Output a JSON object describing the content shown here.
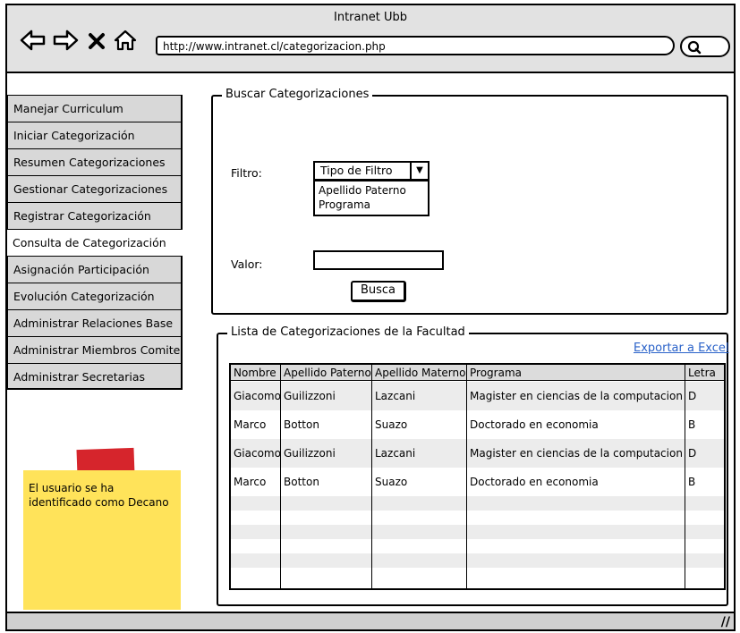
{
  "window": {
    "title": "Intranet Ubb",
    "url": "http://www.intranet.cl/categorizacion.php"
  },
  "sidebar": {
    "items": [
      {
        "label": "Manejar Curriculum"
      },
      {
        "label": "Iniciar Categorización"
      },
      {
        "label": "Resumen Categorizaciones"
      },
      {
        "label": "Gestionar Categorizaciones"
      },
      {
        "label": "Registrar Categorización"
      },
      {
        "label": "Consulta de Categorización"
      },
      {
        "label": "Asignación Participación"
      },
      {
        "label": "Evolución Categorización"
      },
      {
        "label": "Administrar Relaciones Base"
      },
      {
        "label": "Administrar Miembros Comite"
      },
      {
        "label": "Administrar Secretarias"
      }
    ]
  },
  "search_group": {
    "title": "Buscar Categorizaciones",
    "filter_label": "Filtro:",
    "filter_selected": "Tipo de Filtro",
    "filter_options": [
      "Apellido Paterno",
      "Programa"
    ],
    "value_label": "Valor:",
    "value_input": "",
    "search_button": "Busca"
  },
  "list_group": {
    "title": "Lista de Categorizaciones de la Facultad",
    "export_link": "Exportar a Excel",
    "columns": [
      "Nombre",
      "Apellido Paterno",
      "Apellido Materno",
      "Programa",
      "Letra"
    ],
    "rows": [
      [
        "Giacomo",
        "Guilizzoni",
        "Lazcani",
        "Magister en ciencias de la computacion",
        "D"
      ],
      [
        "Marco",
        "Botton",
        "Suazo",
        "Doctorado en economia",
        "B"
      ],
      [
        "Giacomo",
        "Guilizzoni",
        "Lazcani",
        "Magister en ciencias de la computacion",
        "D"
      ],
      [
        "Marco",
        "Botton",
        "Suazo",
        "Doctorado en economia",
        "B"
      ]
    ]
  },
  "sticky_note": {
    "text": "El usuario se ha identificado como Decano"
  }
}
